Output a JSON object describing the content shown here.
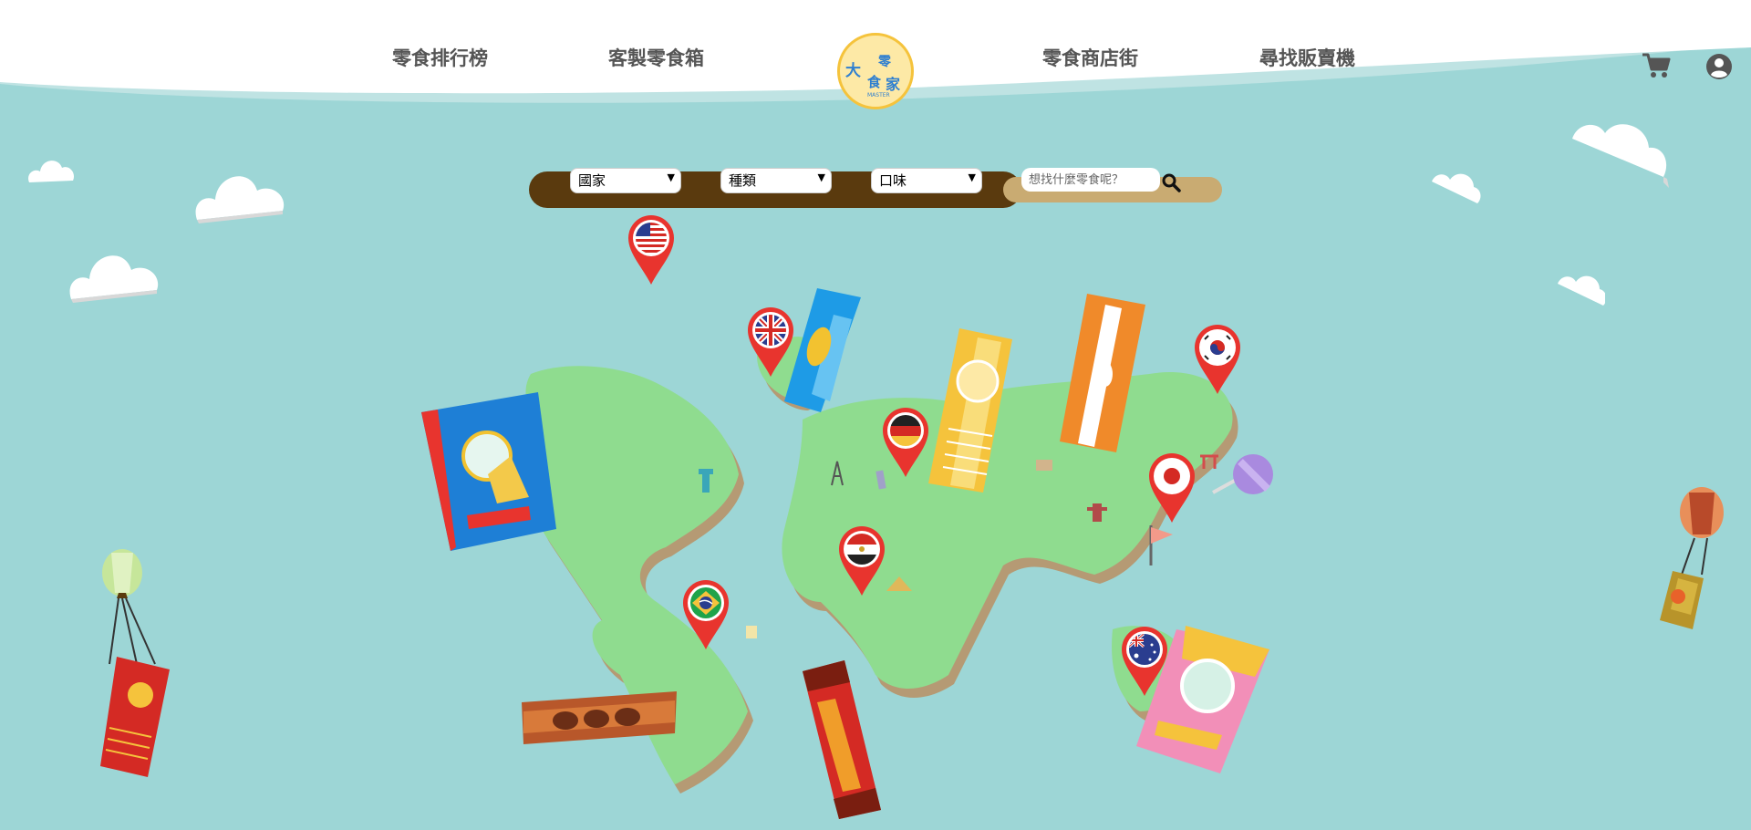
{
  "nav": {
    "items": [
      {
        "label": "零食排行榜"
      },
      {
        "label": "客製零食箱"
      },
      {
        "label": "零食商店街"
      },
      {
        "label": "尋找販賣機"
      }
    ]
  },
  "logo": {
    "c1": "大",
    "c2": "零",
    "c3": "食",
    "c4": "家",
    "sub": "MASTER"
  },
  "filters": {
    "country": "國家",
    "category": "種類",
    "flavor": "口味"
  },
  "search": {
    "placeholder": "想找什麼零食呢？"
  },
  "icons": {
    "cart": "cart-icon",
    "user": "user-icon",
    "search": "search-icon"
  },
  "countries": [
    "usa",
    "uk",
    "germany",
    "korea",
    "japan",
    "egypt",
    "brazil",
    "australia"
  ],
  "colors": {
    "background": "#9dd6d6",
    "land": "#8fdc8f",
    "searchbar": "#5a3a0e",
    "pin": "#e8342e"
  }
}
